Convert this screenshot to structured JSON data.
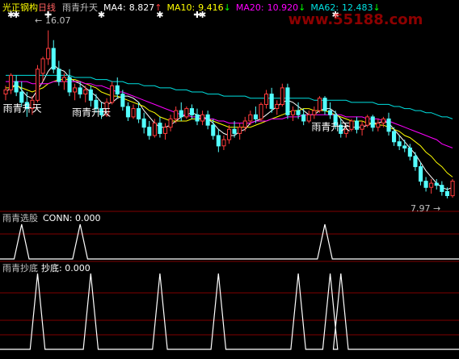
{
  "header": {
    "stock_name": "光正钢构",
    "period": "日线",
    "indicator": "雨青升天",
    "ma4_label": "MA4:",
    "ma4_value": "8.827",
    "ma4_arrow": "↑",
    "ma10_label": "MA10:",
    "ma10_value": "9.416",
    "ma10_arrow": "↓",
    "ma20_label": "MA20:",
    "ma20_value": "10.920",
    "ma20_arrow": "↓",
    "ma62_label": "MA62:",
    "ma62_value": "12.483",
    "ma62_arrow": "↓",
    "watermark": "www.55188.com"
  },
  "colors": {
    "background": "#000000",
    "rise": "#ff3c3c",
    "fall": "#54ffff",
    "ma4": "#ffffff",
    "ma10": "#ffff00",
    "ma20": "#ff00ff",
    "ma62": "#00e0e0",
    "grid": "#800000",
    "signal": "#ffffff",
    "label": "#c0c0c0",
    "stock_name": "#ffff00",
    "period": "#ff6060"
  },
  "chart_data": [
    {
      "type": "candlestick",
      "title": "光正钢构 日线",
      "y_range": [
        7.5,
        16.6
      ],
      "high_label": "16.07",
      "low_label": "7.97",
      "high_marker": "←",
      "low_marker": "→",
      "signal_texts": [
        "雨青升天",
        "雨青升天",
        "雨青升天"
      ],
      "signal_marker": "✱",
      "event_marker": "✚",
      "ohlc": [
        [
          13.0,
          13.4,
          12.7,
          13.2
        ],
        [
          13.2,
          14.0,
          13.0,
          13.9
        ],
        [
          13.6,
          13.9,
          12.9,
          13.1
        ],
        [
          13.1,
          13.6,
          12.4,
          12.6
        ],
        [
          12.6,
          13.1,
          11.9,
          12.3
        ],
        [
          12.3,
          12.9,
          12.0,
          12.7
        ],
        [
          12.7,
          14.4,
          12.6,
          14.2
        ],
        [
          14.0,
          14.8,
          13.6,
          14.7
        ],
        [
          14.7,
          16.07,
          14.4,
          15.2
        ],
        [
          15.2,
          15.6,
          14.0,
          14.2
        ],
        [
          14.2,
          14.6,
          13.4,
          13.6
        ],
        [
          13.6,
          14.0,
          13.2,
          13.8
        ],
        [
          13.8,
          14.2,
          12.9,
          13.1
        ],
        [
          13.1,
          13.5,
          12.7,
          13.3
        ],
        [
          13.3,
          13.6,
          12.8,
          13.0
        ],
        [
          13.0,
          13.4,
          12.6,
          13.2
        ],
        [
          13.2,
          13.4,
          12.4,
          12.7
        ],
        [
          12.7,
          13.0,
          12.1,
          12.3
        ],
        [
          12.3,
          12.6,
          11.8,
          12.0
        ],
        [
          12.0,
          12.8,
          11.9,
          12.6
        ],
        [
          12.6,
          13.6,
          12.5,
          13.4
        ],
        [
          13.4,
          13.8,
          12.8,
          13.0
        ],
        [
          13.0,
          13.2,
          12.2,
          12.4
        ],
        [
          12.4,
          12.6,
          11.7,
          11.9
        ],
        [
          11.9,
          12.5,
          11.8,
          12.3
        ],
        [
          12.3,
          12.6,
          11.6,
          11.8
        ],
        [
          11.8,
          12.1,
          11.1,
          11.4
        ],
        [
          11.4,
          11.7,
          10.8,
          11.0
        ],
        [
          11.0,
          11.8,
          10.9,
          11.6
        ],
        [
          11.6,
          11.9,
          10.9,
          11.1
        ],
        [
          11.1,
          11.6,
          10.8,
          11.4
        ],
        [
          11.4,
          12.0,
          11.2,
          11.8
        ],
        [
          11.8,
          12.4,
          11.6,
          12.2
        ],
        [
          12.2,
          12.6,
          11.7,
          11.9
        ],
        [
          11.9,
          12.4,
          11.8,
          12.3
        ],
        [
          12.3,
          12.5,
          11.8,
          12.0
        ],
        [
          12.0,
          12.3,
          11.5,
          11.7
        ],
        [
          11.7,
          12.2,
          11.5,
          12.0
        ],
        [
          12.0,
          12.2,
          11.3,
          11.5
        ],
        [
          11.5,
          11.8,
          10.8,
          11.0
        ],
        [
          11.0,
          11.3,
          10.2,
          10.5
        ],
        [
          10.5,
          11.0,
          10.3,
          10.8
        ],
        [
          10.8,
          11.5,
          10.6,
          11.3
        ],
        [
          11.3,
          11.7,
          10.9,
          11.1
        ],
        [
          11.1,
          11.6,
          10.8,
          11.4
        ],
        [
          11.4,
          11.9,
          11.2,
          11.7
        ],
        [
          11.7,
          12.2,
          11.5,
          12.0
        ],
        [
          12.0,
          12.4,
          11.6,
          11.8
        ],
        [
          11.8,
          12.6,
          11.7,
          12.5
        ],
        [
          12.5,
          13.2,
          12.3,
          13.0
        ],
        [
          13.0,
          13.3,
          12.1,
          12.3
        ],
        [
          12.3,
          12.7,
          12.0,
          12.5
        ],
        [
          12.5,
          13.5,
          12.4,
          13.3
        ],
        [
          13.3,
          13.5,
          11.8,
          12.0
        ],
        [
          12.0,
          12.4,
          11.7,
          12.2
        ],
        [
          12.2,
          12.6,
          11.8,
          12.0
        ],
        [
          12.0,
          12.3,
          11.5,
          11.7
        ],
        [
          11.7,
          12.2,
          11.6,
          12.0
        ],
        [
          12.0,
          12.4,
          11.8,
          12.2
        ],
        [
          12.2,
          12.9,
          12.1,
          12.8
        ],
        [
          12.8,
          12.9,
          12.0,
          12.2
        ],
        [
          12.2,
          12.6,
          11.8,
          12.0
        ],
        [
          12.0,
          12.2,
          11.3,
          11.5
        ],
        [
          11.5,
          11.8,
          10.9,
          11.1
        ],
        [
          11.1,
          11.5,
          10.9,
          11.3
        ],
        [
          11.3,
          11.8,
          11.2,
          11.7
        ],
        [
          11.7,
          11.9,
          11.1,
          11.3
        ],
        [
          11.3,
          11.7,
          11.0,
          11.5
        ],
        [
          11.5,
          12.0,
          11.4,
          11.9
        ],
        [
          11.9,
          12.0,
          11.2,
          11.4
        ],
        [
          11.4,
          11.8,
          11.2,
          11.6
        ],
        [
          11.6,
          11.9,
          11.4,
          11.8
        ],
        [
          11.8,
          12.1,
          11.0,
          11.2
        ],
        [
          11.2,
          11.4,
          10.5,
          10.7
        ],
        [
          10.7,
          11.0,
          10.3,
          10.5
        ],
        [
          10.5,
          10.8,
          10.2,
          10.4
        ],
        [
          10.4,
          10.6,
          9.8,
          10.0
        ],
        [
          10.0,
          10.2,
          9.3,
          9.5
        ],
        [
          9.5,
          9.7,
          8.6,
          8.8
        ],
        [
          8.8,
          9.0,
          8.3,
          8.5
        ],
        [
          8.5,
          8.9,
          8.2,
          8.7
        ],
        [
          8.7,
          8.9,
          8.4,
          8.6
        ],
        [
          8.6,
          8.8,
          8.1,
          8.3
        ],
        [
          8.3,
          8.5,
          7.97,
          8.1
        ],
        [
          8.1,
          8.9,
          8.0,
          8.8
        ]
      ],
      "ma_values": [
        {
          "name": "MA4",
          "values": [
            13.1,
            13.3,
            13.5,
            13.2,
            12.9,
            12.8,
            13.2,
            13.6,
            14.1,
            14.4,
            14.2,
            14.1,
            13.8,
            13.6,
            13.5,
            13.3,
            13.1,
            12.9,
            12.6,
            12.5,
            12.6,
            12.8,
            12.9,
            12.9,
            12.8,
            12.6,
            12.2,
            11.9,
            11.6,
            11.4,
            11.4,
            11.5,
            11.7,
            11.9,
            12.0,
            12.1,
            12.0,
            11.9,
            11.8,
            11.6,
            11.3,
            11.1,
            11.0,
            11.0,
            11.2,
            11.3,
            11.6,
            11.7,
            11.8,
            12.0,
            12.2,
            12.4,
            12.6,
            12.7,
            12.6,
            12.4,
            12.2,
            12.0,
            12.0,
            12.2,
            12.3,
            12.3,
            12.1,
            11.8,
            11.5,
            11.4,
            11.4,
            11.4,
            11.5,
            11.6,
            11.6,
            11.7,
            11.6,
            11.3,
            11.0,
            10.7,
            10.4,
            10.1,
            9.7,
            9.3,
            9.0,
            8.7,
            8.5,
            8.4,
            8.5
          ]
        },
        {
          "name": "MA10",
          "values": [
            13.3,
            13.3,
            13.4,
            13.3,
            13.2,
            13.1,
            13.2,
            13.3,
            13.5,
            13.6,
            13.7,
            13.7,
            13.7,
            13.7,
            13.6,
            13.5,
            13.4,
            13.3,
            13.1,
            13.0,
            12.9,
            12.9,
            12.8,
            12.7,
            12.6,
            12.5,
            12.4,
            12.2,
            12.1,
            11.9,
            11.8,
            11.7,
            11.7,
            11.7,
            11.7,
            11.8,
            11.8,
            11.8,
            11.8,
            11.7,
            11.6,
            11.5,
            11.4,
            11.4,
            11.4,
            11.4,
            11.4,
            11.5,
            11.6,
            11.7,
            11.8,
            11.9,
            12.0,
            12.1,
            12.2,
            12.2,
            12.3,
            12.3,
            12.2,
            12.2,
            12.2,
            12.1,
            12.0,
            11.9,
            11.8,
            11.7,
            11.7,
            11.7,
            11.6,
            11.6,
            11.5,
            11.5,
            11.4,
            11.3,
            11.2,
            11.0,
            10.9,
            10.7,
            10.5,
            10.2,
            10.0,
            9.7,
            9.5,
            9.2,
            9.0
          ]
        },
        {
          "name": "MA20",
          "values": [
            13.6,
            13.6,
            13.6,
            13.6,
            13.6,
            13.5,
            13.5,
            13.5,
            13.5,
            13.6,
            13.6,
            13.6,
            13.6,
            13.6,
            13.6,
            13.5,
            13.5,
            13.4,
            13.4,
            13.3,
            13.2,
            13.1,
            13.1,
            13.0,
            12.9,
            12.8,
            12.7,
            12.6,
            12.5,
            12.4,
            12.3,
            12.2,
            12.1,
            12.0,
            12.0,
            11.9,
            11.9,
            11.8,
            11.8,
            11.8,
            11.7,
            11.7,
            11.6,
            11.6,
            11.6,
            11.6,
            11.6,
            11.7,
            11.7,
            11.7,
            11.8,
            11.8,
            11.8,
            11.9,
            11.9,
            11.9,
            12.0,
            12.0,
            12.0,
            12.0,
            12.0,
            12.0,
            12.0,
            12.0,
            11.9,
            11.9,
            11.9,
            11.9,
            11.8,
            11.8,
            11.8,
            11.7,
            11.7,
            11.6,
            11.5,
            11.4,
            11.3,
            11.2,
            11.1,
            11.0,
            10.9,
            10.8,
            10.6,
            10.5,
            10.4
          ]
        },
        {
          "name": "MA62",
          "values": [
            13.9,
            13.9,
            13.9,
            13.9,
            13.9,
            13.9,
            13.9,
            13.9,
            13.9,
            13.9,
            13.9,
            13.9,
            13.9,
            13.8,
            13.8,
            13.8,
            13.8,
            13.7,
            13.7,
            13.7,
            13.6,
            13.6,
            13.6,
            13.5,
            13.5,
            13.5,
            13.4,
            13.4,
            13.4,
            13.3,
            13.3,
            13.3,
            13.2,
            13.2,
            13.2,
            13.1,
            13.1,
            13.1,
            13.0,
            13.0,
            13.0,
            12.9,
            12.9,
            12.9,
            12.9,
            12.9,
            12.8,
            12.8,
            12.8,
            12.8,
            12.8,
            12.8,
            12.8,
            12.8,
            12.8,
            12.8,
            12.8,
            12.8,
            12.7,
            12.7,
            12.7,
            12.7,
            12.7,
            12.7,
            12.7,
            12.6,
            12.6,
            12.6,
            12.6,
            12.6,
            12.5,
            12.5,
            12.5,
            12.4,
            12.4,
            12.3,
            12.3,
            12.2,
            12.2,
            12.1,
            12.1,
            12.0,
            11.9,
            11.9,
            11.8
          ]
        }
      ],
      "signal_days": [
        1,
        2,
        18,
        29,
        37,
        62
      ],
      "event_days": [
        8,
        36
      ],
      "signal_text_days": [
        1,
        14,
        59
      ]
    },
    {
      "type": "line",
      "title": "雨青选股",
      "series": [
        {
          "name": "CONN",
          "current_value": "0.000",
          "spike_days": [
            3,
            14,
            60
          ]
        }
      ]
    },
    {
      "type": "line",
      "title": "雨青抄底",
      "series": [
        {
          "name": "抄底",
          "current_value": "0.000",
          "spike_days": [
            6,
            16,
            29,
            40,
            55,
            61,
            63
          ]
        }
      ]
    }
  ]
}
